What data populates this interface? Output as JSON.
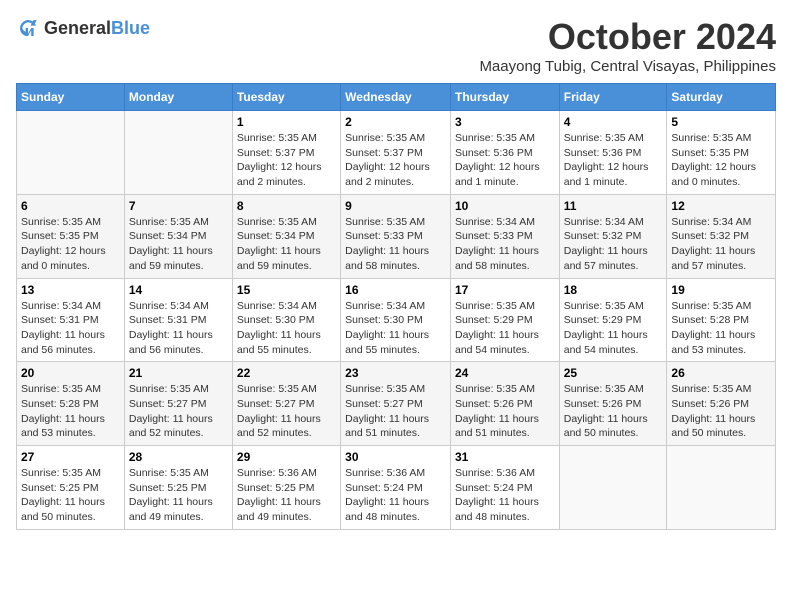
{
  "logo": {
    "general": "General",
    "blue": "Blue"
  },
  "title": "October 2024",
  "location": "Maayong Tubig, Central Visayas, Philippines",
  "headers": [
    "Sunday",
    "Monday",
    "Tuesday",
    "Wednesday",
    "Thursday",
    "Friday",
    "Saturday"
  ],
  "weeks": [
    [
      {
        "day": "",
        "info": ""
      },
      {
        "day": "",
        "info": ""
      },
      {
        "day": "1",
        "sunrise": "Sunrise: 5:35 AM",
        "sunset": "Sunset: 5:37 PM",
        "daylight": "Daylight: 12 hours and 2 minutes."
      },
      {
        "day": "2",
        "sunrise": "Sunrise: 5:35 AM",
        "sunset": "Sunset: 5:37 PM",
        "daylight": "Daylight: 12 hours and 2 minutes."
      },
      {
        "day": "3",
        "sunrise": "Sunrise: 5:35 AM",
        "sunset": "Sunset: 5:36 PM",
        "daylight": "Daylight: 12 hours and 1 minute."
      },
      {
        "day": "4",
        "sunrise": "Sunrise: 5:35 AM",
        "sunset": "Sunset: 5:36 PM",
        "daylight": "Daylight: 12 hours and 1 minute."
      },
      {
        "day": "5",
        "sunrise": "Sunrise: 5:35 AM",
        "sunset": "Sunset: 5:35 PM",
        "daylight": "Daylight: 12 hours and 0 minutes."
      }
    ],
    [
      {
        "day": "6",
        "sunrise": "Sunrise: 5:35 AM",
        "sunset": "Sunset: 5:35 PM",
        "daylight": "Daylight: 12 hours and 0 minutes."
      },
      {
        "day": "7",
        "sunrise": "Sunrise: 5:35 AM",
        "sunset": "Sunset: 5:34 PM",
        "daylight": "Daylight: 11 hours and 59 minutes."
      },
      {
        "day": "8",
        "sunrise": "Sunrise: 5:35 AM",
        "sunset": "Sunset: 5:34 PM",
        "daylight": "Daylight: 11 hours and 59 minutes."
      },
      {
        "day": "9",
        "sunrise": "Sunrise: 5:35 AM",
        "sunset": "Sunset: 5:33 PM",
        "daylight": "Daylight: 11 hours and 58 minutes."
      },
      {
        "day": "10",
        "sunrise": "Sunrise: 5:34 AM",
        "sunset": "Sunset: 5:33 PM",
        "daylight": "Daylight: 11 hours and 58 minutes."
      },
      {
        "day": "11",
        "sunrise": "Sunrise: 5:34 AM",
        "sunset": "Sunset: 5:32 PM",
        "daylight": "Daylight: 11 hours and 57 minutes."
      },
      {
        "day": "12",
        "sunrise": "Sunrise: 5:34 AM",
        "sunset": "Sunset: 5:32 PM",
        "daylight": "Daylight: 11 hours and 57 minutes."
      }
    ],
    [
      {
        "day": "13",
        "sunrise": "Sunrise: 5:34 AM",
        "sunset": "Sunset: 5:31 PM",
        "daylight": "Daylight: 11 hours and 56 minutes."
      },
      {
        "day": "14",
        "sunrise": "Sunrise: 5:34 AM",
        "sunset": "Sunset: 5:31 PM",
        "daylight": "Daylight: 11 hours and 56 minutes."
      },
      {
        "day": "15",
        "sunrise": "Sunrise: 5:34 AM",
        "sunset": "Sunset: 5:30 PM",
        "daylight": "Daylight: 11 hours and 55 minutes."
      },
      {
        "day": "16",
        "sunrise": "Sunrise: 5:34 AM",
        "sunset": "Sunset: 5:30 PM",
        "daylight": "Daylight: 11 hours and 55 minutes."
      },
      {
        "day": "17",
        "sunrise": "Sunrise: 5:35 AM",
        "sunset": "Sunset: 5:29 PM",
        "daylight": "Daylight: 11 hours and 54 minutes."
      },
      {
        "day": "18",
        "sunrise": "Sunrise: 5:35 AM",
        "sunset": "Sunset: 5:29 PM",
        "daylight": "Daylight: 11 hours and 54 minutes."
      },
      {
        "day": "19",
        "sunrise": "Sunrise: 5:35 AM",
        "sunset": "Sunset: 5:28 PM",
        "daylight": "Daylight: 11 hours and 53 minutes."
      }
    ],
    [
      {
        "day": "20",
        "sunrise": "Sunrise: 5:35 AM",
        "sunset": "Sunset: 5:28 PM",
        "daylight": "Daylight: 11 hours and 53 minutes."
      },
      {
        "day": "21",
        "sunrise": "Sunrise: 5:35 AM",
        "sunset": "Sunset: 5:27 PM",
        "daylight": "Daylight: 11 hours and 52 minutes."
      },
      {
        "day": "22",
        "sunrise": "Sunrise: 5:35 AM",
        "sunset": "Sunset: 5:27 PM",
        "daylight": "Daylight: 11 hours and 52 minutes."
      },
      {
        "day": "23",
        "sunrise": "Sunrise: 5:35 AM",
        "sunset": "Sunset: 5:27 PM",
        "daylight": "Daylight: 11 hours and 51 minutes."
      },
      {
        "day": "24",
        "sunrise": "Sunrise: 5:35 AM",
        "sunset": "Sunset: 5:26 PM",
        "daylight": "Daylight: 11 hours and 51 minutes."
      },
      {
        "day": "25",
        "sunrise": "Sunrise: 5:35 AM",
        "sunset": "Sunset: 5:26 PM",
        "daylight": "Daylight: 11 hours and 50 minutes."
      },
      {
        "day": "26",
        "sunrise": "Sunrise: 5:35 AM",
        "sunset": "Sunset: 5:26 PM",
        "daylight": "Daylight: 11 hours and 50 minutes."
      }
    ],
    [
      {
        "day": "27",
        "sunrise": "Sunrise: 5:35 AM",
        "sunset": "Sunset: 5:25 PM",
        "daylight": "Daylight: 11 hours and 50 minutes."
      },
      {
        "day": "28",
        "sunrise": "Sunrise: 5:35 AM",
        "sunset": "Sunset: 5:25 PM",
        "daylight": "Daylight: 11 hours and 49 minutes."
      },
      {
        "day": "29",
        "sunrise": "Sunrise: 5:36 AM",
        "sunset": "Sunset: 5:25 PM",
        "daylight": "Daylight: 11 hours and 49 minutes."
      },
      {
        "day": "30",
        "sunrise": "Sunrise: 5:36 AM",
        "sunset": "Sunset: 5:24 PM",
        "daylight": "Daylight: 11 hours and 48 minutes."
      },
      {
        "day": "31",
        "sunrise": "Sunrise: 5:36 AM",
        "sunset": "Sunset: 5:24 PM",
        "daylight": "Daylight: 11 hours and 48 minutes."
      },
      {
        "day": "",
        "info": ""
      },
      {
        "day": "",
        "info": ""
      }
    ]
  ]
}
